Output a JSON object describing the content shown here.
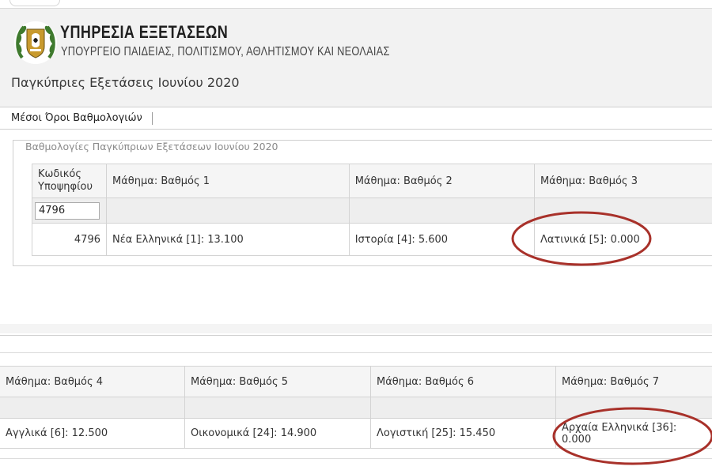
{
  "header": {
    "org_title": "ΥΠΗΡΕΣΙΑ ΕΞΕΤΑΣΕΩΝ",
    "org_subtitle": "ΥΠΟΥΡΓΕΙΟ ΠΑΙΔΕΙΑΣ, ΠΟΛΙΤΙΣΜΟΥ, ΑΘΛΗΤΙΣΜΟΥ ΚΑΙ ΝΕΟΛΑΙΑΣ",
    "exam_title": "Παγκύπριες Εξετάσεις Ιουνίου 2020"
  },
  "menu": {
    "items": [
      {
        "label": "Μέσοι Όροι Βαθμολογιών"
      }
    ]
  },
  "grades_panel": {
    "legend": "Βαθμολογίες Παγκύπριων Εξετάσεων Ιουνίου 2020",
    "table1": {
      "headers": [
        "Κωδικός Υποψηφίου",
        "Μάθημα: Βαθμός 1",
        "Μάθημα: Βαθμός 2",
        "Μάθημα: Βαθμός 3"
      ],
      "filter_value": "4796",
      "row": [
        "4796",
        "Νέα Ελληνικά [1]: 13.100",
        "Ιστορία [4]: 5.600",
        "Λατινικά [5]: 0.000"
      ]
    },
    "table2": {
      "headers": [
        "Μάθημα: Βαθμός 4",
        "Μάθημα: Βαθμός 5",
        "Μάθημα: Βαθμός 6",
        "Μάθημα: Βαθμός 7"
      ],
      "row": [
        "Αγγλικά [6]: 12.500",
        "Οικονομικά [24]: 14.900",
        "Λογιστική [25]: 15.450",
        "Αρχαία Ελληνικά [36]: 0.000"
      ]
    }
  },
  "colors": {
    "annotation_circle": "#a8312a",
    "header_bg": "#f2f2f2",
    "logo_green": "#3f7a2e"
  },
  "icons": [
    "cyprus-emblem-logo"
  ]
}
